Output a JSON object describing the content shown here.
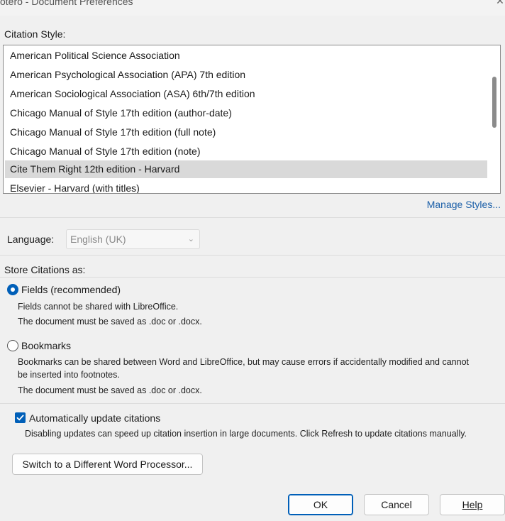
{
  "window": {
    "title": "otero - Document Preferences"
  },
  "citation_style": {
    "label": "Citation Style:",
    "items": [
      "American Political Science Association",
      "American Psychological Association (APA) 7th edition",
      "American Sociological Association (ASA) 6th/7th edition",
      "Chicago Manual of Style 17th edition (author-date)",
      "Chicago Manual of Style 17th edition (full note)",
      "Chicago Manual of Style 17th edition (note)",
      "Cite Them Right 12th edition - Harvard",
      "Elsevier - Harvard (with titles)"
    ],
    "selected_index": 6,
    "manage_link": "Manage Styles..."
  },
  "language": {
    "label": "Language:",
    "value": "English (UK)"
  },
  "store": {
    "label": "Store Citations as:",
    "fields": {
      "label": "Fields (recommended)",
      "desc1": "Fields cannot be shared with LibreOffice.",
      "desc2": "The document must be saved as .doc or .docx."
    },
    "bookmarks": {
      "label": "Bookmarks",
      "desc1": "Bookmarks can be shared between Word and LibreOffice, but may cause errors if accidentally modified and cannot",
      "desc1b": "be inserted into footnotes.",
      "desc2": "The document must be saved as .doc or .docx."
    },
    "selected": "fields"
  },
  "auto_update": {
    "label": "Automatically update citations",
    "checked": true,
    "desc": "Disabling updates can speed up citation insertion in large documents. Click Refresh to update citations manually."
  },
  "switch_button": "Switch to a Different Word Processor...",
  "buttons": {
    "ok": "OK",
    "cancel": "Cancel",
    "help": "Help"
  },
  "colors": {
    "accent": "#005fb8",
    "link": "#1b5fa8",
    "selection": "#d9d9d9"
  }
}
